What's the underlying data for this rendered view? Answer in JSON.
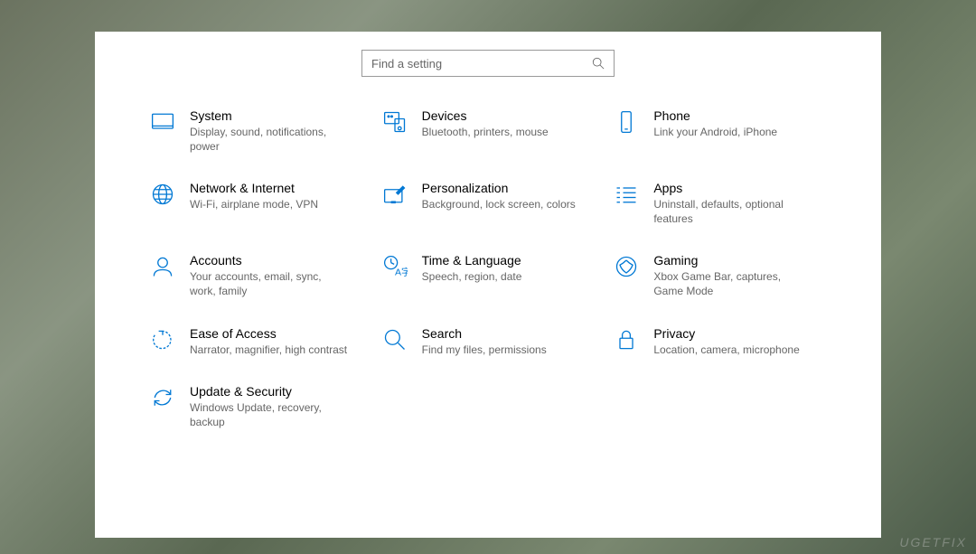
{
  "search": {
    "placeholder": "Find a setting"
  },
  "accent_color": "#0078d4",
  "tiles": {
    "system": {
      "title": "System",
      "desc": "Display, sound, notifications, power"
    },
    "devices": {
      "title": "Devices",
      "desc": "Bluetooth, printers, mouse"
    },
    "phone": {
      "title": "Phone",
      "desc": "Link your Android, iPhone"
    },
    "network": {
      "title": "Network & Internet",
      "desc": "Wi-Fi, airplane mode, VPN"
    },
    "personalization": {
      "title": "Personalization",
      "desc": "Background, lock screen, colors"
    },
    "apps": {
      "title": "Apps",
      "desc": "Uninstall, defaults, optional features"
    },
    "accounts": {
      "title": "Accounts",
      "desc": "Your accounts, email, sync, work, family"
    },
    "time": {
      "title": "Time & Language",
      "desc": "Speech, region, date"
    },
    "gaming": {
      "title": "Gaming",
      "desc": "Xbox Game Bar, captures, Game Mode"
    },
    "ease": {
      "title": "Ease of Access",
      "desc": "Narrator, magnifier, high contrast"
    },
    "search_tile": {
      "title": "Search",
      "desc": "Find my files, permissions"
    },
    "privacy": {
      "title": "Privacy",
      "desc": "Location, camera, microphone"
    },
    "update": {
      "title": "Update & Security",
      "desc": "Windows Update, recovery, backup"
    }
  },
  "watermark": "UGETFIX"
}
